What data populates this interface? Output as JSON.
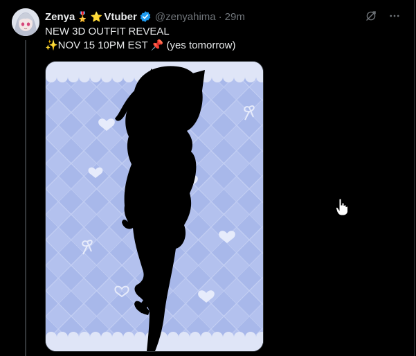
{
  "tweet": {
    "display_name": "Zenya",
    "badge_emojis": [
      "🎖️",
      "⭐"
    ],
    "name_suffix": "Vtuber",
    "handle": "@zenyahima",
    "separator": "·",
    "time": "29m",
    "text_line1": "NEW 3D OUTFIT REVEAL",
    "text_line2": "✨NOV 15 10PM EST 📌 (yes tomorrow)"
  },
  "actions": [
    "grok-icon",
    "more-icon"
  ],
  "colors": {
    "background": "#000000",
    "text": "#e7e9ea",
    "muted": "#71767b",
    "verified": "#1d9bf0",
    "media_bg": "#b7c5ef"
  }
}
